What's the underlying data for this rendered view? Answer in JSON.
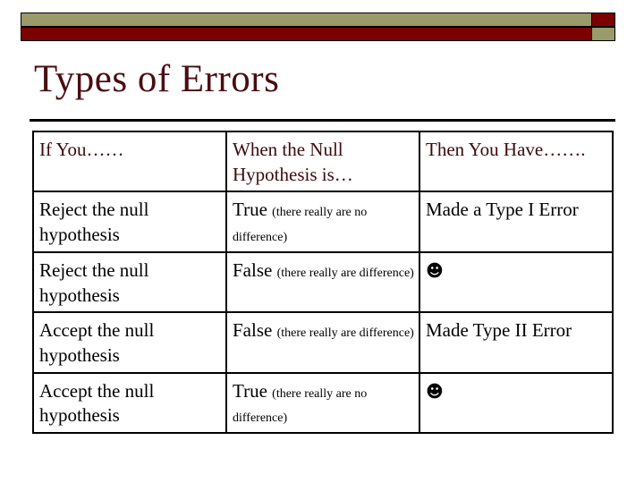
{
  "slide": {
    "title": "Types of Errors",
    "banner": {
      "top_long_color": "#9a9a6b",
      "top_short_color": "#7d0000",
      "bottom_long_color": "#7d0000",
      "bottom_short_color": "#9a9a6b"
    },
    "title_color": "#4a0d12"
  },
  "table": {
    "headers": [
      "If You……",
      "When the Null Hypothesis is…",
      "Then You Have……."
    ],
    "rows": [
      {
        "action": "Reject the null hypothesis",
        "truth_main": "True ",
        "truth_note": "(there really are no difference)",
        "result": "Made a Type I Error",
        "result_icon": ""
      },
      {
        "action": "Reject the null hypothesis",
        "truth_main": "False ",
        "truth_note": "(there really are difference)",
        "result": "",
        "result_icon": "☻"
      },
      {
        "action": "Accept the null hypothesis",
        "truth_main": "False ",
        "truth_note": "(there really are difference)",
        "result": "Made Type II Error",
        "result_icon": ""
      },
      {
        "action": "Accept the null hypothesis",
        "truth_main": "True ",
        "truth_note": "(there really are no difference)",
        "result": "",
        "result_icon": "☻"
      }
    ]
  }
}
